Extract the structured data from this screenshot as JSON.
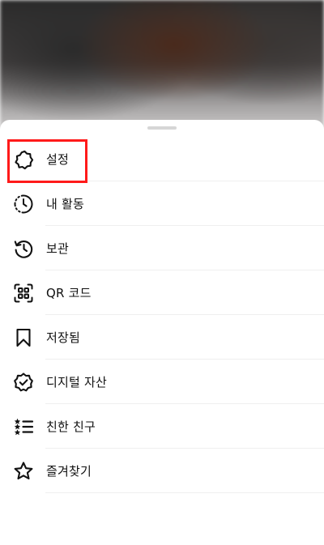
{
  "menu": {
    "items": [
      {
        "label": "설정",
        "icon": "settings-gear-icon"
      },
      {
        "label": "내 활동",
        "icon": "activity-icon"
      },
      {
        "label": "보관",
        "icon": "archive-history-icon"
      },
      {
        "label": "QR 코드",
        "icon": "qr-code-icon"
      },
      {
        "label": "저장됨",
        "icon": "bookmark-icon"
      },
      {
        "label": "디지털 자산",
        "icon": "shield-check-icon"
      },
      {
        "label": "친한 친구",
        "icon": "close-friends-list-icon"
      },
      {
        "label": "즐겨찾기",
        "icon": "star-icon"
      }
    ]
  },
  "colors": {
    "highlight": "#ff1a1a",
    "text": "#111111",
    "divider": "#efefef"
  }
}
